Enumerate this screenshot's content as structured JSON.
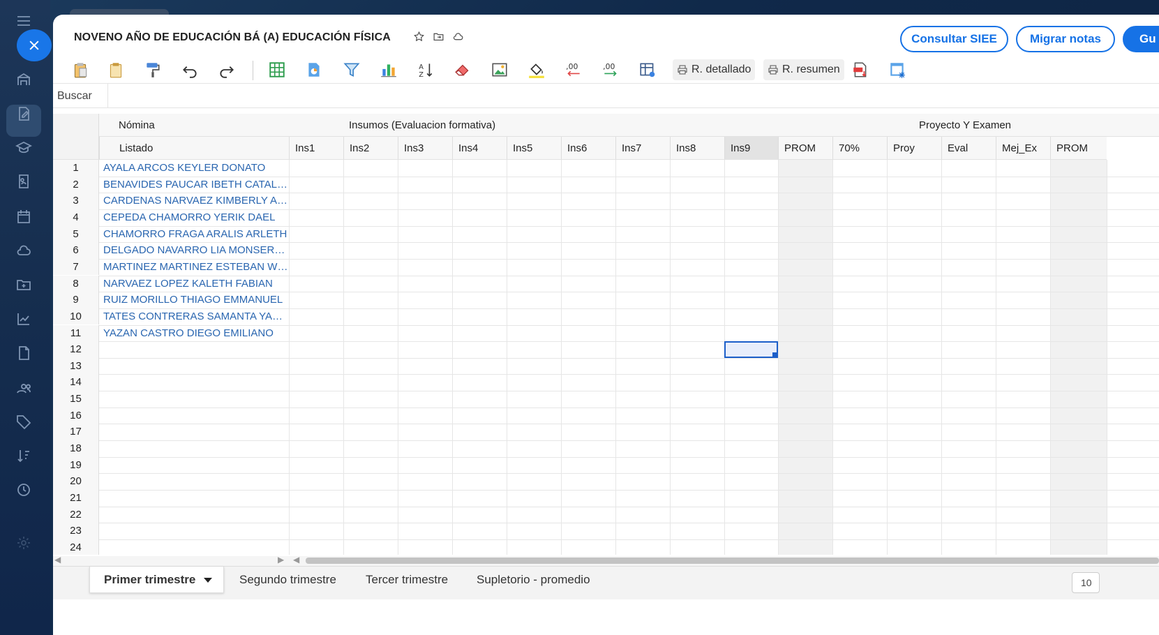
{
  "window": {
    "title": "NOVENO AÑO DE EDUCACIÓN BÁ (A) EDUCACIÓN FÍSICA"
  },
  "header_buttons": {
    "consultar": "Consultar SIEE",
    "migrar": "Migrar notas",
    "third": "Gu"
  },
  "toolbar": {
    "r_detallado": "R. detallado",
    "r_resumen": "R. resumen",
    "decimal_decrease": ",00",
    "decimal_increase": ",00"
  },
  "search": {
    "label": "Buscar",
    "value": ""
  },
  "grid": {
    "groups": {
      "nomina": "Nómina",
      "insumos": "Insumos (Evaluacion formativa)",
      "proyecto": "Proyecto Y Examen"
    },
    "columns": [
      "Listado",
      "Ins1",
      "Ins2",
      "Ins3",
      "Ins4",
      "Ins5",
      "Ins6",
      "Ins7",
      "Ins8",
      "Ins9",
      "PROM",
      "70%",
      "Proy",
      "Eval",
      "Mej_Ex",
      "PROM"
    ],
    "row_numbers": [
      "1",
      "2",
      "3",
      "4",
      "5",
      "6",
      "7",
      "8",
      "9",
      "10",
      "11",
      "12",
      "13",
      "14",
      "15",
      "16",
      "17",
      "18",
      "19",
      "20",
      "21",
      "22",
      "23",
      "24"
    ],
    "students": [
      "AYALA ARCOS KEYLER DONATO",
      "BENAVIDES PAUCAR IBETH CATALEYA",
      "CARDENAS NARVAEZ KIMBERLY ADA...",
      "CEPEDA CHAMORRO YERIK DAEL",
      "CHAMORRO FRAGA ARALIS ARLETH",
      "DELGADO NAVARRO LIA MONSERRATH",
      "MARTINEZ MARTINEZ ESTEBAN WLADI...",
      "NARVAEZ LOPEZ KALETH FABIAN",
      "RUIZ MORILLO THIAGO EMMANUEL",
      "TATES CONTRERAS SAMANTA YAMILETH",
      "YAZAN CASTRO DIEGO EMILIANO"
    ]
  },
  "sheet_tabs": [
    {
      "label": "Primer trimestre",
      "active": true
    },
    {
      "label": "Segundo trimestre",
      "active": false
    },
    {
      "label": "Tercer trimestre",
      "active": false
    },
    {
      "label": "Supletorio - promedio",
      "active": false
    }
  ],
  "zoom": "10",
  "colors": {
    "accent": "#1672e6",
    "student_text": "#2a66b0",
    "rail": "#152d4e"
  }
}
